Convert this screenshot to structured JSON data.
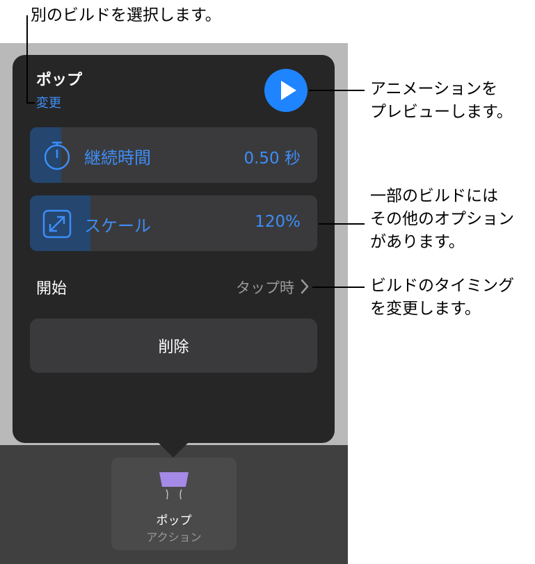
{
  "callouts": {
    "change_build": "別のビルドを選択します。",
    "preview_line1": "アニメーションを",
    "preview_line2": "プレビューします。",
    "options_line1": "一部のビルドには",
    "options_line2": "その他のオプション",
    "options_line3": "があります。",
    "timing_line1": "ビルドのタイミング",
    "timing_line2": "を変更します。"
  },
  "popover": {
    "title": "ポップ",
    "change_label": "変更",
    "play_icon": "play-icon",
    "duration": {
      "icon": "stopwatch-icon",
      "label": "継続時間",
      "value": "0.50 秒",
      "fill_fraction": 0.11
    },
    "scale": {
      "icon": "expand-icon",
      "label": "スケール",
      "value": "120%",
      "fill_fraction": 0.21
    },
    "start": {
      "label": "開始",
      "value": "タップ時"
    },
    "delete_label": "削除"
  },
  "build_tile": {
    "icon": "pop-build-icon",
    "name": "ポップ",
    "type": "アクション"
  },
  "colors": {
    "accent": "#1f84ff",
    "popover_bg": "#262626",
    "row_bg": "#3a3a3c",
    "slider_fill": "#24466f"
  }
}
